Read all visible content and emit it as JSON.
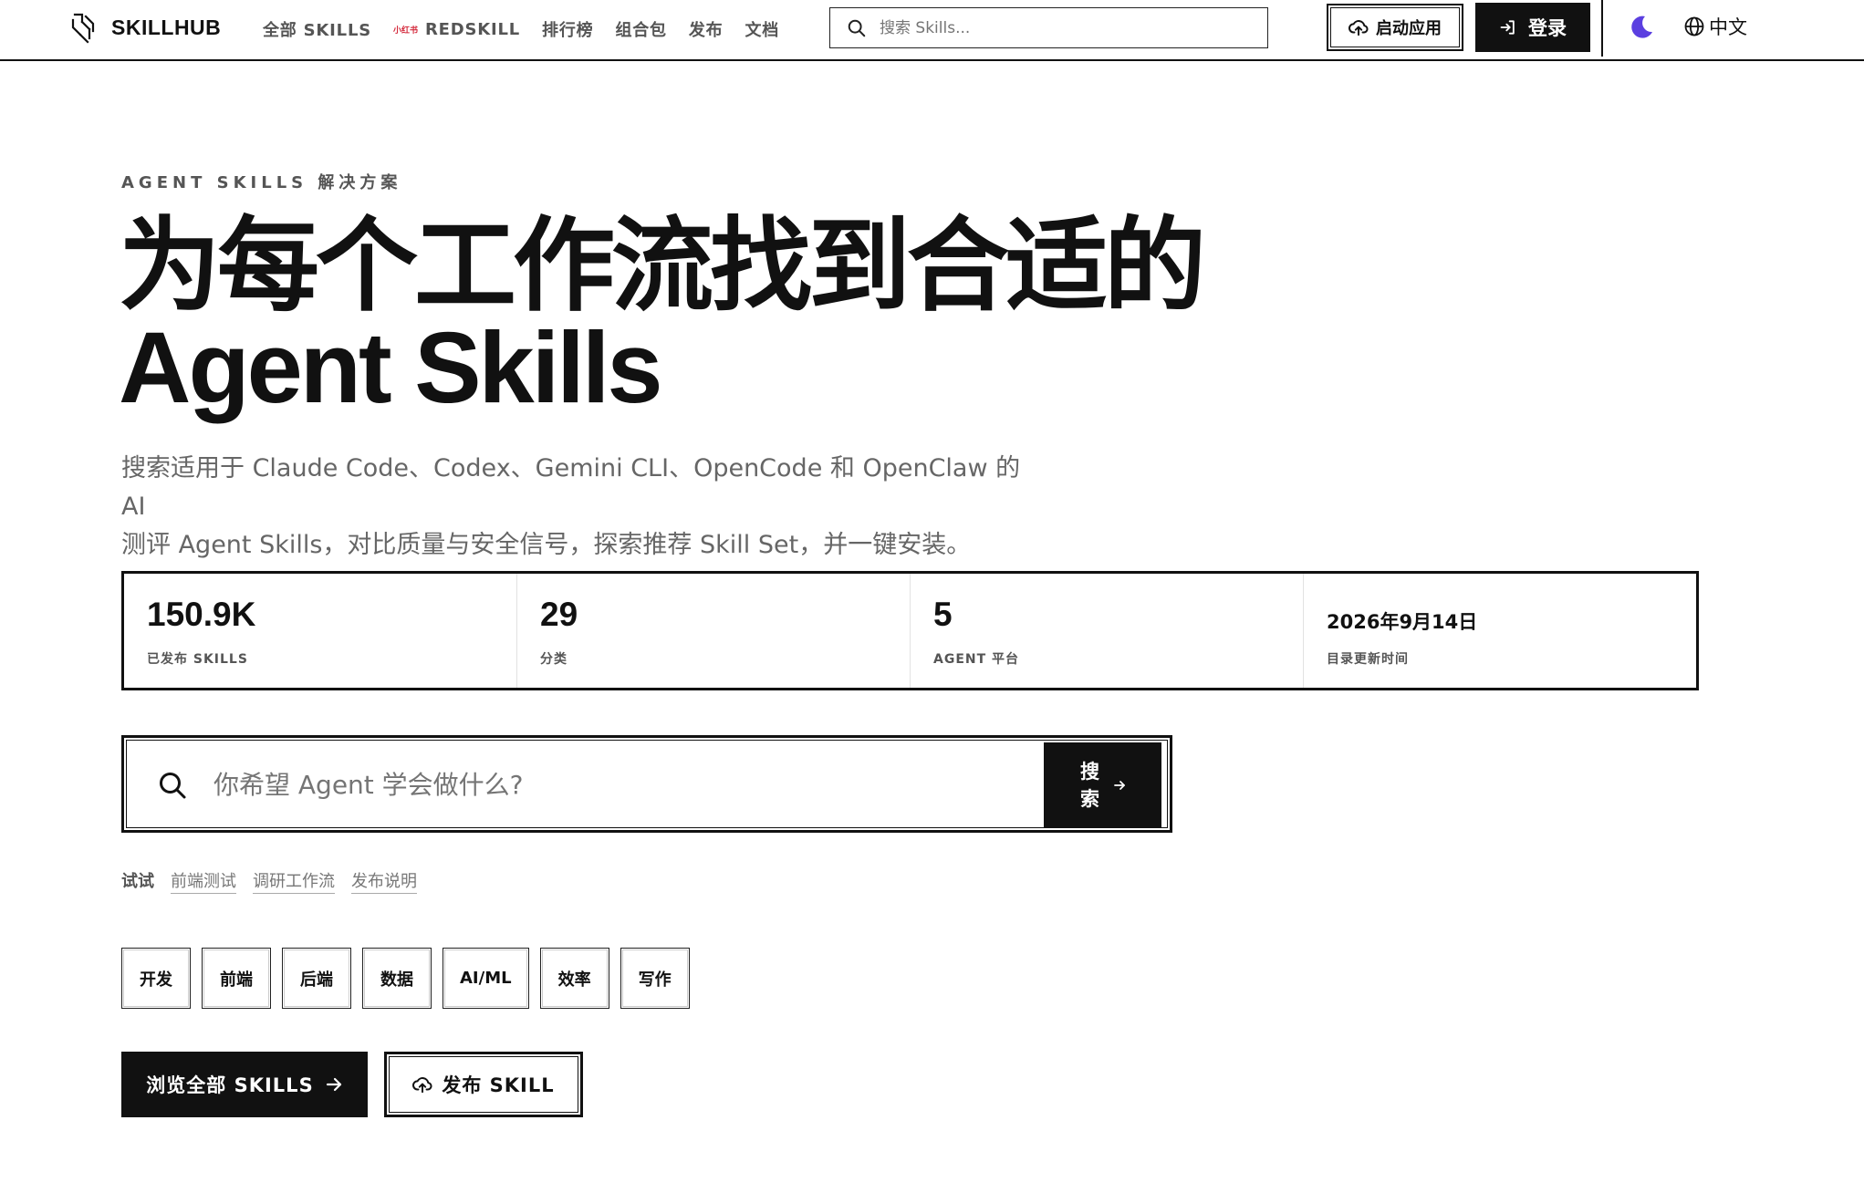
{
  "header": {
    "brand": "SKILLHUB",
    "nav": {
      "all_skills": "全部 SKILLS",
      "redskill_badge": "小红书",
      "redskill": "REDSKILL",
      "leaderboard": "排行榜",
      "bundles": "组合包",
      "publish": "发布",
      "docs": "文档"
    },
    "search_placeholder": "搜索 Skills...",
    "launch_app": "启动应用",
    "login": "登录",
    "language": "中文",
    "theme_color": "#5b3fe0"
  },
  "hero": {
    "eyebrow": "AGENT SKILLS 解决方案",
    "title_line1": "为每个工作流找到合适的",
    "title_line2": "Agent Skills",
    "subtitle_line1": "搜索适用于 Claude Code、Codex、Gemini CLI、OpenCode 和 OpenClaw 的 AI",
    "subtitle_line2": "测评 Agent Skills，对比质量与安全信号，探索推荐 Skill Set，并一键安装。"
  },
  "stats": [
    {
      "value": "150.9K",
      "label": "已发布 SKILLS"
    },
    {
      "value": "29",
      "label": "分类"
    },
    {
      "value": "5",
      "label": "AGENT 平台"
    },
    {
      "value": "2026年9月14日",
      "label": "目录更新时间"
    }
  ],
  "search": {
    "placeholder": "你希望 Agent 学会做什么?",
    "button": "搜索"
  },
  "try": {
    "label": "试试",
    "items": [
      "前端测试",
      "调研工作流",
      "发布说明"
    ]
  },
  "tags": [
    "开发",
    "前端",
    "后端",
    "数据",
    "AI/ML",
    "效率",
    "写作"
  ],
  "cta": {
    "browse": "浏览全部 SKILLS",
    "publish": "发布 SKILL"
  }
}
